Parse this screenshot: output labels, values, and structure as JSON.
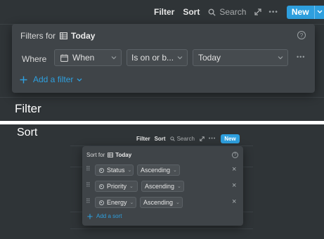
{
  "filter_section": {
    "toolbar": {
      "filter": "Filter",
      "sort": "Sort",
      "search": "Search",
      "expand_icon": "expand-icon",
      "more": "•••",
      "new": "New"
    },
    "popover": {
      "title_prefix": "Filters for",
      "view_name": "Today",
      "where_label": "Where",
      "property": "When",
      "operator": "Is on or b...",
      "value": "Today",
      "more": "•••",
      "add_filter": "Add a filter",
      "help": "?"
    },
    "caption": "Filter"
  },
  "sort_section": {
    "caption": "Sort",
    "toolbar": {
      "filter": "Filter",
      "sort": "Sort",
      "search": "Search",
      "more": "•••",
      "new": "New"
    },
    "popover": {
      "title_prefix": "Sort for",
      "view_name": "Today",
      "help": "?",
      "rows": [
        {
          "property": "Status",
          "direction": "Ascending"
        },
        {
          "property": "Priority",
          "direction": "Ascending"
        },
        {
          "property": "Energy",
          "direction": "Ascending"
        }
      ],
      "add_sort": "Add a sort"
    }
  },
  "colors": {
    "background": "#2f3437",
    "popover": "#3f4448",
    "accent": "#2e9fde",
    "divider": "#ffffff"
  }
}
